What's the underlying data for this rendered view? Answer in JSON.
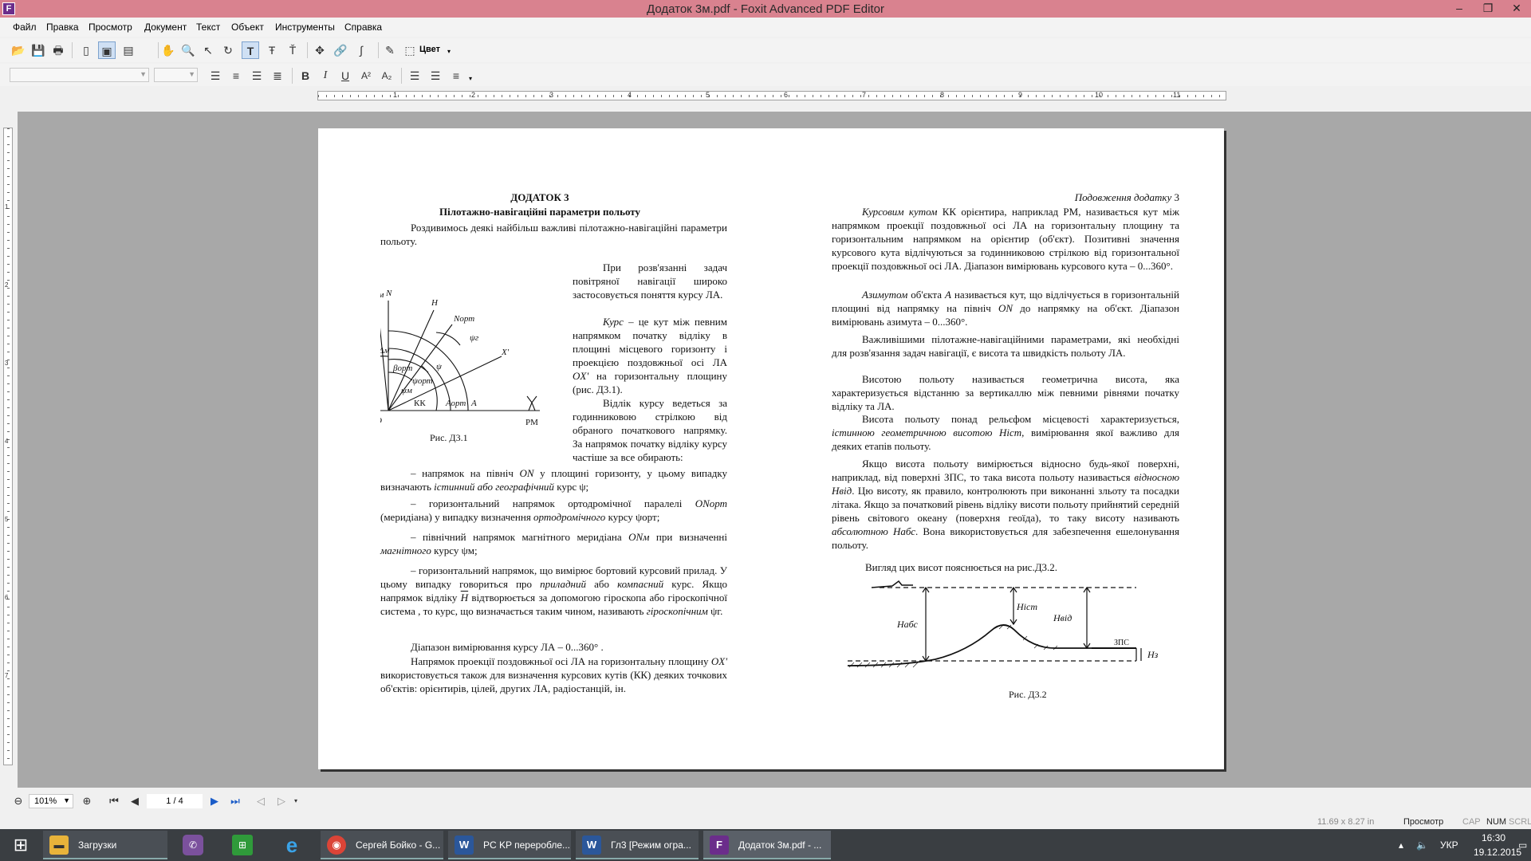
{
  "window": {
    "title": "Додаток 3м.pdf - Foxit Advanced PDF Editor"
  },
  "menu": [
    "Файл",
    "Правка",
    "Просмотр",
    "Документ",
    "Текст",
    "Объект",
    "Инструменты",
    "Справка"
  ],
  "toolbar": {
    "color_label": "Цвет"
  },
  "ruler": {
    "numbers": [
      "1",
      "2",
      "3",
      "4",
      "5",
      "6",
      "7",
      "8",
      "9",
      "10",
      "11"
    ]
  },
  "doc": {
    "left": {
      "heading": "ДОДАТОК 3",
      "subheading": "Пілотажно-навігаційні параметри польоту",
      "intro": "Роздивимось деякі найбільш важливі пілотажно-навігаційні параметри польоту.",
      "p1": "При розв'язанні задач повітряної навігації широко застосовується поняття курсу ЛА.",
      "p2_term": "Курс",
      "p2_a": " – це кут між певним напрямком початку відліку в площині місцевого горизонту і проекцією поздовжньої осі ЛА ",
      "p2_ox": "OX'",
      "p2_b": " на горизонтальну площину (рис. Д3.1).",
      "p3": "Відлік курсу ведеться за годинниковою стрілкою від обраного початкового напрямку. За напрямок початку відліку курсу частіше за все обирають:",
      "fig_caption": "Рис. Д3.1",
      "li1_a": "–    напрямок на північ ",
      "li1_on": "ON",
      "li1_b": " у площині горизонту, у цьому випадку визначають ",
      "li1_it": "істинний або географічний",
      "li1_c": " курс ψ;",
      "li2_a": "–    горизонтальний напрямок ортодромічної паралелі ",
      "li2_on": "ONорт",
      "li2_b": " (меридіана) у випадку визначення ",
      "li2_it": "ортодромічного",
      "li2_c": " курсу ψорт;",
      "li3_a": "–    північний напрямок магнітного меридіана ",
      "li3_on": "ONм",
      "li3_b": " при визначенні ",
      "li3_it": "магнітного",
      "li3_c": " курсу ψм;",
      "li4_a": "–    горизонтальний напрямок, що вимірює бортовий курсовий прилад. У цьому випадку говориться про ",
      "li4_it1": "приладний",
      "li4_b": " або ",
      "li4_it2": "компасний",
      "li4_c": " курс. Якщо напрямок відліку ",
      "li4_h": "H",
      "li4_d": " відтворюється за допомогою гіроскопа або гіроскопічної система , то курс, що визначається таким чином, називають ",
      "li4_it3": "гіроскопічним",
      "li4_e": " ψг.",
      "range": "Діапазон вимірювання курсу ЛА – 0...360° .",
      "last_a": "Напрямок проекції поздовжньої осі ЛА на горизонтальну площину ",
      "last_ox": "OX'",
      "last_b": " використовується також для визначення курсових кутів (КК) деяких точкових об'єктів: орієнтирів, цілей, других ЛА, радіостанцій, ін."
    },
    "right": {
      "header_it": "Подовження додатку",
      "header_num": " 3",
      "r1_it": "Курсовим кутом",
      "r1": " КК орієнтира, наприклад РМ, називається кут між напрямком проекції поздовжньої осі ЛА на горизонтальну площину та горизонтальним напрямком на орієнтир (об'єкт). Позитивні значення курсового кута відлічуються за годинниковою стрілкою від горизонтальної проекції поздовжньої осі ЛА. Діапазон вимірювань курсового кута – 0...360°.",
      "r2_it": "Азимутом",
      "r2_a": " об'єкта ",
      "r2_A": "А",
      "r2_b": " називається кут, що відлічується в горизонтальній площині від напрямку на північ ",
      "r2_on": "ON",
      "r2_c": " до напрямку на об'єкт. Діапазон вимірювань азимута – 0...360°.",
      "r3": "Важливішими пілотажне-навігаційними параметрами, які необхідні для розв'язання задач навігації, є висота та швидкість польоту ЛА.",
      "r4": "Висотою польоту називається геометрична висота, яка характеризується відстанню за вертикаллю між певними рівнями початку відліку та ЛА.",
      "r5_a": "Висота польоту понад рельєфом місцевості характеризується, ",
      "r5_it": "істинною геометричною висотою",
      "r5_h": "Hіст",
      "r5_b": ", вимірювання якої важливо для деяких етапів польоту.",
      "r6_a": "Якщо висота польоту вимірюється відносно будь-якої поверхні, наприклад, від поверхні ЗПС, то така висота польоту називається ",
      "r6_it": "відносною",
      "r6_h": "Hвід",
      "r6_b": ". Цю висоту, як правило, контролюють при виконанні зльоту та посадки літака. Якщо за початковий рівень відліку висоти польоту прийнятий середній рівень світового океану (поверхня геоїда), то таку висоту називають ",
      "r6_it2": "абсолютною",
      "r6_h2": "Hабс",
      "r6_c": ". Вона використовується для забезпечення ешелонування польоту.",
      "r7": "Вигляд цих висот пояснюється на рис.Д3.2.",
      "fig_caption": "Рис. Д3.2"
    },
    "fig1_labels": {
      "nm": "Nм",
      "n": "N",
      "h": "H",
      "nort": "Nорт",
      "psig": "ψг",
      "x": "X'",
      "dm": "Δм",
      "bort": "βорт",
      "psi": "ψ",
      "psiort": "ψорт",
      "psim": "ψм",
      "kk": "КК",
      "aort": "Аорт",
      "a": "А",
      "o": "O",
      "pm": "РМ"
    },
    "fig2_labels": {
      "habs": "Hабс",
      "hist": "Hіст",
      "hvid": "Hвід",
      "zps": "ЗПС",
      "hz": "Hз"
    }
  },
  "nav": {
    "zoom": "101%",
    "page": "1 / 4"
  },
  "status": {
    "size": "11.69 x 8.27 in",
    "mode": "Просмотр",
    "cap": "CAP",
    "num": "NUM",
    "scrl": "SCRL"
  },
  "taskbar": {
    "items": [
      "Загрузки",
      "Сергей Бойко - G...",
      "PC KP переробле...",
      "Гл3 [Режим огра...",
      "Додаток 3м.pdf - ..."
    ],
    "lang": "УКР",
    "time": "16:30",
    "date": "19.12.2015"
  }
}
